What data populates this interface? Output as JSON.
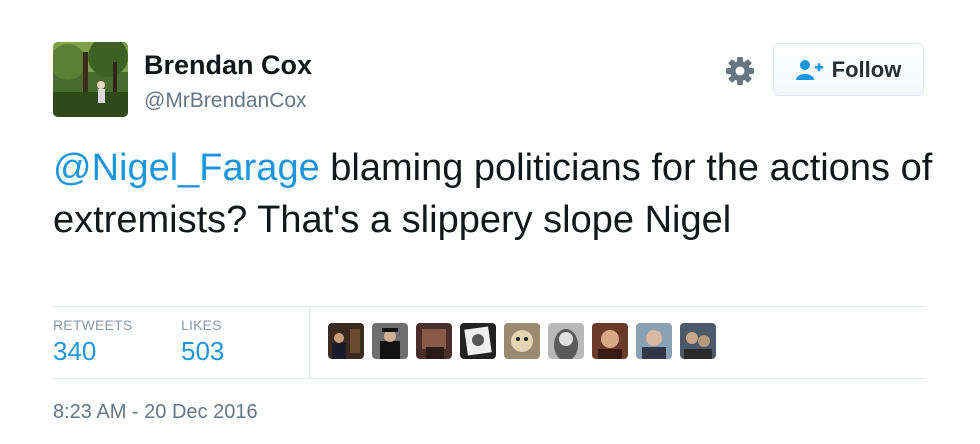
{
  "user": {
    "name": "Brendan Cox",
    "handle": "@MrBrendanCox"
  },
  "follow_button": {
    "label": "Follow"
  },
  "tweet": {
    "mention": "@Nigel_Farage",
    "text": " blaming politicians for the actions of extremists? That's a slippery slope Nigel"
  },
  "stats": {
    "retweets_label": "RETWEETS",
    "retweets_value": "340",
    "likes_label": "LIKES",
    "likes_value": "503"
  },
  "timestamp": "8:23 AM - 20 Dec 2016",
  "icons": {
    "settings": "gear-icon",
    "follow": "add-user-icon"
  },
  "colors": {
    "link": "#1b95e0",
    "secondary_text": "#657786",
    "border": "#e1e8ed"
  },
  "liker_avatars_count": 9
}
